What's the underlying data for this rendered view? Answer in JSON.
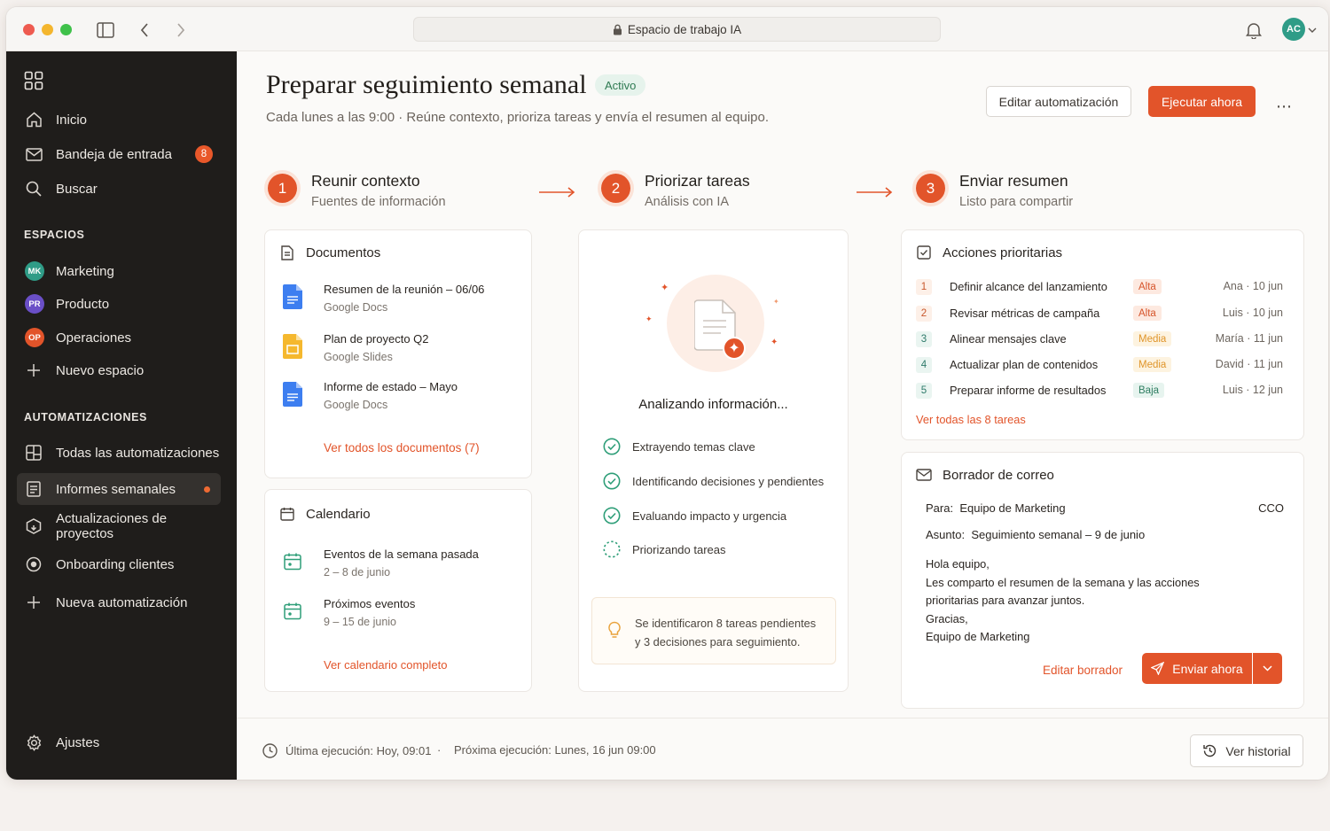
{
  "titlebar": {
    "url": "Espacio de trabajo IA",
    "avatar": "AC"
  },
  "sidebar": {
    "primary": [
      {
        "label": "Inicio",
        "icon": "home-icon"
      },
      {
        "label": "Bandeja de entrada",
        "icon": "inbox-icon",
        "badge": "8"
      },
      {
        "label": "Buscar",
        "icon": "search-icon"
      }
    ],
    "spaces_title": "ESPACIOS",
    "spaces": [
      {
        "label": "Marketing",
        "initials": "MK",
        "color": "#2f9c87"
      },
      {
        "label": "Producto",
        "initials": "PR",
        "color": "#6a4fc7"
      },
      {
        "label": "Operaciones",
        "initials": "OP",
        "color": "#e2542a"
      },
      {
        "label": "Nuevo espacio"
      }
    ],
    "automations_title": "AUTOMATIZACIONES",
    "automations": [
      {
        "label": "Todas las automatizaciones",
        "icon": "grid-icon"
      },
      {
        "label": "Informes semanales",
        "icon": "report-icon",
        "active": true
      },
      {
        "label": "Actualizaciones de proyectos",
        "icon": "box-icon"
      },
      {
        "label": "Onboarding clientes",
        "icon": "target-icon"
      },
      {
        "label": "Nueva automatización",
        "icon": "plus-icon"
      }
    ],
    "settings": "Ajustes"
  },
  "header": {
    "title": "Preparar seguimiento semanal",
    "status": "Activo",
    "subtitle": "Cada lunes a las 9:00 · Reúne contexto, prioriza tareas y envía el resumen al equipo.",
    "edit_button": "Editar automatización",
    "run_button": "Ejecutar ahora"
  },
  "steps": [
    {
      "num": "1",
      "title": "Reunir contexto",
      "sub": "Fuentes de información"
    },
    {
      "num": "2",
      "title": "Priorizar tareas",
      "sub": "Análisis con IA"
    },
    {
      "num": "3",
      "title": "Enviar resumen",
      "sub": "Listo para compartir"
    }
  ],
  "documents": {
    "title": "Documentos",
    "items": [
      {
        "name": "Resumen de la reunión – 06/06",
        "source": "Google Docs"
      },
      {
        "name": "Plan de proyecto Q2",
        "source": "Google Slides"
      },
      {
        "name": "Informe de estado – Mayo",
        "source": "Google Docs"
      }
    ],
    "link": "Ver todos los documentos (7)"
  },
  "calendar": {
    "title": "Calendario",
    "items": [
      {
        "name": "Eventos de la semana pasada",
        "dates": "2 – 8 de junio"
      },
      {
        "name": "Próximos eventos",
        "dates": "9 – 15 de junio"
      }
    ],
    "link": "Ver calendario completo"
  },
  "analysis": {
    "title": "Analizando información...",
    "steps": [
      {
        "label": "Extrayendo temas clave",
        "done": true
      },
      {
        "label": "Identificando decisiones y pendientes",
        "done": true
      },
      {
        "label": "Evaluando impacto y urgencia",
        "done": true
      },
      {
        "label": "Priorizando tareas",
        "done": false
      }
    ],
    "insight_line1": "Se identificaron 8 tareas pendientes",
    "insight_line2": "y 3 decisiones para seguimiento."
  },
  "actions": {
    "title": "Acciones prioritarias",
    "tasks": [
      {
        "n": "1",
        "task": "Definir alcance del lanzamiento",
        "priority": "Alta",
        "assignee": "Ana · 10 jun"
      },
      {
        "n": "2",
        "task": "Revisar métricas de campaña",
        "priority": "Alta",
        "assignee": "Luis · 10 jun"
      },
      {
        "n": "3",
        "task": "Alinear mensajes clave",
        "priority": "Media",
        "assignee": "María · 11 jun"
      },
      {
        "n": "4",
        "task": "Actualizar plan de contenidos",
        "priority": "Media",
        "assignee": "David · 11 jun"
      },
      {
        "n": "5",
        "task": "Preparar informe de resultados",
        "priority": "Baja",
        "assignee": "Luis · 12 jun"
      }
    ],
    "link": "Ver todas las 8 tareas"
  },
  "email": {
    "title": "Borrador de correo",
    "to_label": "Para:",
    "to": "Equipo de Marketing",
    "cco": "CCO",
    "subject_label": "Asunto:",
    "subject": "Seguimiento semanal – 9 de junio",
    "body": [
      "Hola equipo,",
      "Les comparto el resumen de la semana y las acciones",
      "prioritarias para avanzar juntos.",
      "Gracias,",
      "Equipo de Marketing"
    ],
    "edit_link": "Editar borrador",
    "send_button": "Enviar ahora"
  },
  "footer": {
    "last_run": "Última ejecución: Hoy, 09:01",
    "next_run": "Próxima ejecución: Lunes, 16 jun 09:00",
    "history_button": "Ver historial"
  },
  "colors": {
    "accent": "#e2542a",
    "sidebar": "#1f1d1b",
    "success": "#2e9e78"
  }
}
